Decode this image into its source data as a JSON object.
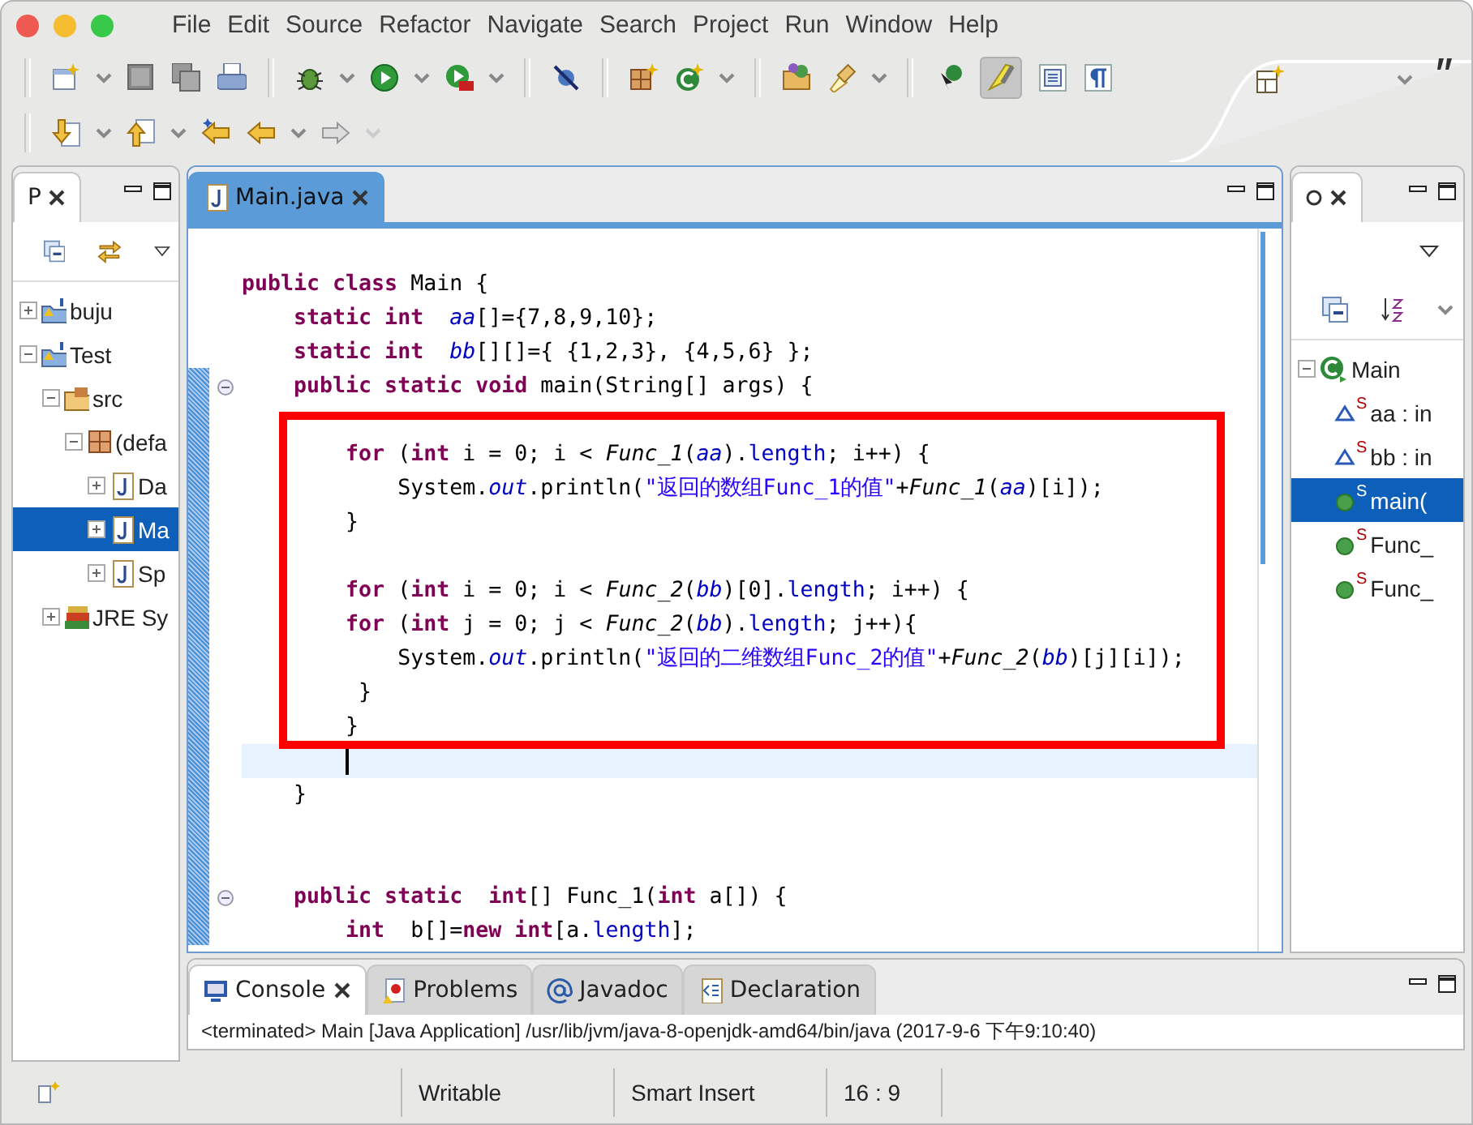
{
  "menu": [
    "File",
    "Edit",
    "Source",
    "Refactor",
    "Navigate",
    "Search",
    "Project",
    "Run",
    "Window",
    "Help"
  ],
  "toolbar": {
    "highlight_toggle": {
      "pressed": true
    }
  },
  "package_explorer": {
    "tab": {
      "label": "P",
      "selected": true
    },
    "tree": [
      {
        "label": "buju",
        "kind": "project",
        "expanded": false,
        "selected": false
      },
      {
        "label": "Test",
        "kind": "project",
        "expanded": true,
        "selected": false,
        "children": [
          {
            "label": "src",
            "kind": "folder",
            "expanded": true,
            "selected": false,
            "children": [
              {
                "label": "(defa",
                "kind": "package",
                "expanded": true,
                "selected": false,
                "children": [
                  {
                    "label": "Da",
                    "kind": "file",
                    "expanded": false,
                    "selected": false
                  },
                  {
                    "label": "Ma",
                    "kind": "file",
                    "expanded": false,
                    "selected": true
                  },
                  {
                    "label": "Sp",
                    "kind": "file",
                    "expanded": false,
                    "selected": false
                  }
                ]
              }
            ]
          },
          {
            "label": "JRE Sy",
            "kind": "library",
            "expanded": false,
            "selected": false
          }
        ]
      }
    ]
  },
  "editor": {
    "tab": {
      "label": "Main.java",
      "selected": true
    },
    "lines": [
      {
        "fold": false,
        "current": false
      },
      {
        "fold": false,
        "current": false,
        "tokens": [
          {
            "kind": "kw",
            "text": "public class"
          },
          {
            "kind": "plain",
            "text": " Main {"
          }
        ]
      },
      {
        "fold": false,
        "current": false,
        "tokens": [
          {
            "kind": "kw",
            "text": "    static int  "
          },
          {
            "kind": "sfield",
            "text": "aa"
          },
          {
            "kind": "plain",
            "text": "[]={7,8,9,10};"
          }
        ]
      },
      {
        "fold": false,
        "current": false,
        "tokens": [
          {
            "kind": "kw",
            "text": "    static int  "
          },
          {
            "kind": "sfield",
            "text": "bb"
          },
          {
            "kind": "plain",
            "text": "[][]={ {1,2,3}, {4,5,6} };"
          }
        ]
      },
      {
        "fold": true,
        "current": false,
        "tokens": [
          {
            "kind": "kw",
            "text": "    public static void"
          },
          {
            "kind": "plain",
            "text": " main(String[] args) {"
          }
        ]
      },
      {
        "fold": false,
        "current": false
      },
      {
        "fold": false,
        "current": false,
        "tokens": [
          {
            "kind": "kw",
            "text": "        for"
          },
          {
            "kind": "plain",
            "text": " ("
          },
          {
            "kind": "kw",
            "text": "int"
          },
          {
            "kind": "plain",
            "text": " i = 0; i < "
          },
          {
            "kind": "smethod",
            "text": "Func_1"
          },
          {
            "kind": "plain",
            "text": "("
          },
          {
            "kind": "sfield",
            "text": "aa"
          },
          {
            "kind": "plain",
            "text": ")."
          },
          {
            "kind": "field",
            "text": "length"
          },
          {
            "kind": "plain",
            "text": "; i++) {"
          }
        ]
      },
      {
        "fold": false,
        "current": false,
        "tokens": [
          {
            "kind": "plain",
            "text": "            System."
          },
          {
            "kind": "sfield",
            "text": "out"
          },
          {
            "kind": "plain",
            "text": ".println("
          },
          {
            "kind": "str",
            "text": "\"返回的数组Func_1的值\""
          },
          {
            "kind": "plain",
            "text": "+"
          },
          {
            "kind": "smethod",
            "text": "Func_1"
          },
          {
            "kind": "plain",
            "text": "("
          },
          {
            "kind": "sfield",
            "text": "aa"
          },
          {
            "kind": "plain",
            "text": ")[i]);"
          }
        ]
      },
      {
        "fold": false,
        "current": false,
        "tokens": [
          {
            "kind": "plain",
            "text": "        }"
          }
        ]
      },
      {
        "fold": false,
        "current": false
      },
      {
        "fold": false,
        "current": false,
        "tokens": [
          {
            "kind": "kw",
            "text": "        for"
          },
          {
            "kind": "plain",
            "text": " ("
          },
          {
            "kind": "kw",
            "text": "int"
          },
          {
            "kind": "plain",
            "text": " i = 0; i < "
          },
          {
            "kind": "smethod",
            "text": "Func_2"
          },
          {
            "kind": "plain",
            "text": "("
          },
          {
            "kind": "sfield",
            "text": "bb"
          },
          {
            "kind": "plain",
            "text": ")[0]."
          },
          {
            "kind": "field",
            "text": "length"
          },
          {
            "kind": "plain",
            "text": "; i++) {"
          }
        ]
      },
      {
        "fold": false,
        "current": false,
        "tokens": [
          {
            "kind": "kw",
            "text": "        for"
          },
          {
            "kind": "plain",
            "text": " ("
          },
          {
            "kind": "kw",
            "text": "int"
          },
          {
            "kind": "plain",
            "text": " j = 0; j < "
          },
          {
            "kind": "smethod",
            "text": "Func_2"
          },
          {
            "kind": "plain",
            "text": "("
          },
          {
            "kind": "sfield",
            "text": "bb"
          },
          {
            "kind": "plain",
            "text": ")."
          },
          {
            "kind": "field",
            "text": "length"
          },
          {
            "kind": "plain",
            "text": "; j++){"
          }
        ]
      },
      {
        "fold": false,
        "current": false,
        "tokens": [
          {
            "kind": "plain",
            "text": "            System."
          },
          {
            "kind": "sfield",
            "text": "out"
          },
          {
            "kind": "plain",
            "text": ".println("
          },
          {
            "kind": "str",
            "text": "\"返回的二维数组Func_2的值\""
          },
          {
            "kind": "plain",
            "text": "+"
          },
          {
            "kind": "smethod",
            "text": "Func_2"
          },
          {
            "kind": "plain",
            "text": "("
          },
          {
            "kind": "sfield",
            "text": "bb"
          },
          {
            "kind": "plain",
            "text": ")[j][i]);"
          }
        ]
      },
      {
        "fold": false,
        "current": false,
        "tokens": [
          {
            "kind": "plain",
            "text": "         }"
          }
        ]
      },
      {
        "fold": false,
        "current": false,
        "tokens": [
          {
            "kind": "plain",
            "text": "        }"
          }
        ]
      },
      {
        "fold": false,
        "current": true
      },
      {
        "fold": false,
        "current": false,
        "tokens": [
          {
            "kind": "plain",
            "text": "    }"
          }
        ]
      },
      {
        "fold": false,
        "current": false
      },
      {
        "fold": false,
        "current": false
      },
      {
        "fold": true,
        "current": false,
        "tokens": [
          {
            "kind": "kw",
            "text": "    public static  int"
          },
          {
            "kind": "plain",
            "text": "[] Func_1("
          },
          {
            "kind": "kw",
            "text": "int"
          },
          {
            "kind": "plain",
            "text": " a[]) {"
          }
        ]
      },
      {
        "fold": false,
        "current": false,
        "tokens": [
          {
            "kind": "kw",
            "text": "        int"
          },
          {
            "kind": "plain",
            "text": "  b[]="
          },
          {
            "kind": "kw",
            "text": "new int"
          },
          {
            "kind": "plain",
            "text": "[a."
          },
          {
            "kind": "field",
            "text": "length"
          },
          {
            "kind": "plain",
            "text": "];"
          }
        ]
      }
    ]
  },
  "outline": {
    "tab": {
      "selected": true
    },
    "tree": [
      {
        "label": "Main",
        "kind": "class",
        "expanded": true,
        "selected": false,
        "children": [
          {
            "label": "aa : in",
            "kind": "field",
            "badge": "S",
            "selected": false
          },
          {
            "label": "bb : in",
            "kind": "field",
            "badge": "S",
            "selected": false
          },
          {
            "label": "main(",
            "kind": "method",
            "badge": "S",
            "selected": true
          },
          {
            "label": "Func_",
            "kind": "method",
            "badge": "S",
            "selected": false
          },
          {
            "label": "Func_",
            "kind": "method",
            "badge": "S",
            "selected": false
          }
        ]
      }
    ]
  },
  "bottom_tabs": [
    {
      "label": "Console",
      "kind": "console",
      "selected": true
    },
    {
      "label": "Problems",
      "kind": "problems",
      "selected": false
    },
    {
      "label": "Javadoc",
      "kind": "javadoc",
      "selected": false
    },
    {
      "label": "Declaration",
      "kind": "declaration",
      "selected": false
    }
  ],
  "console_text": "<terminated> Main [Java Application] /usr/lib/jvm/java-8-openjdk-amd64/bin/java (2017-9-6 下午9:10:40)",
  "status_bar": [
    "Writable",
    "Smart Insert",
    "16 : 9"
  ]
}
